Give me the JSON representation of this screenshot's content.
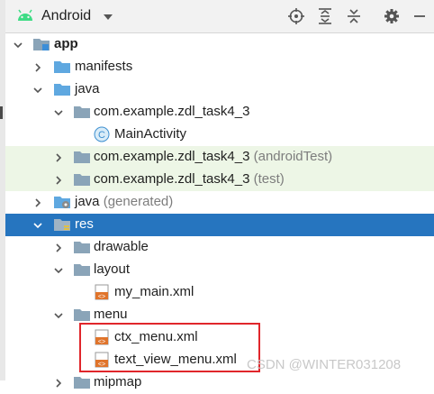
{
  "toolbar": {
    "view_label": "Android",
    "buttons": [
      "locate-icon",
      "expand-all-icon",
      "collapse-all-icon",
      "settings-gear-icon",
      "hide-panel-icon"
    ]
  },
  "tree": {
    "app": "app",
    "manifests": "manifests",
    "java": "java",
    "pkg_main": "com.example.zdl_task4_3",
    "main_activity": "MainActivity",
    "pkg_android_test": "com.example.zdl_task4_3",
    "android_test_suffix": "(androidTest)",
    "pkg_test": "com.example.zdl_task4_3",
    "test_suffix": "(test)",
    "java_generated": "java",
    "generated_suffix": "(generated)",
    "res": "res",
    "drawable": "drawable",
    "layout": "layout",
    "my_main": "my_main.xml",
    "menu": "menu",
    "ctx_menu": "ctx_menu.xml",
    "text_view_menu": "text_view_menu.xml",
    "mipmap": "mipmap"
  },
  "watermark": "CSDN @WINTER031208",
  "colors": {
    "selection": "#2675bf",
    "test_row_bg": "#edf6e6",
    "highlight_box": "#e0262b",
    "folder": "#8aa4b8",
    "xml_icon": "#e0742b"
  }
}
